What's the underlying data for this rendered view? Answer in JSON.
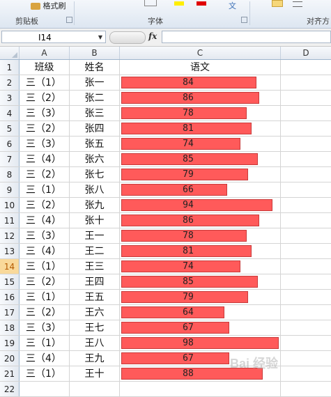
{
  "ribbon": {
    "format_painter": "格式刷",
    "groups": [
      "剪贴板",
      "字体",
      "对齐方"
    ]
  },
  "formula_bar": {
    "name_box": "I14",
    "fx": "fx",
    "formula": ""
  },
  "columns": [
    "A",
    "B",
    "C",
    "D"
  ],
  "headers": {
    "class": "班级",
    "name": "姓名",
    "chinese": "语文"
  },
  "active_row": 14,
  "rows": [
    {
      "class": "三（1）",
      "name": "张一",
      "score": 84
    },
    {
      "class": "三（2）",
      "name": "张二",
      "score": 86
    },
    {
      "class": "三（3）",
      "name": "张三",
      "score": 78
    },
    {
      "class": "三（2）",
      "name": "张四",
      "score": 81
    },
    {
      "class": "三（3）",
      "name": "张五",
      "score": 74
    },
    {
      "class": "三（4）",
      "name": "张六",
      "score": 85
    },
    {
      "class": "三（2）",
      "name": "张七",
      "score": 79
    },
    {
      "class": "三（1）",
      "name": "张八",
      "score": 66
    },
    {
      "class": "三（2）",
      "name": "张九",
      "score": 94
    },
    {
      "class": "三（4）",
      "name": "张十",
      "score": 86
    },
    {
      "class": "三（3）",
      "name": "王一",
      "score": 78
    },
    {
      "class": "三（4）",
      "name": "王二",
      "score": 81
    },
    {
      "class": "三（1）",
      "name": "王三",
      "score": 74
    },
    {
      "class": "三（2）",
      "name": "王四",
      "score": 85
    },
    {
      "class": "三（1）",
      "name": "王五",
      "score": 79
    },
    {
      "class": "三（2）",
      "name": "王六",
      "score": 64
    },
    {
      "class": "三（3）",
      "name": "王七",
      "score": 67
    },
    {
      "class": "三（1）",
      "name": "王八",
      "score": 98
    },
    {
      "class": "三（4）",
      "name": "王九",
      "score": 67
    },
    {
      "class": "三（1）",
      "name": "王十",
      "score": 88
    }
  ],
  "databar": {
    "fill": "#ff5a5a",
    "max_value": 98
  },
  "watermark": "Bai 经验"
}
